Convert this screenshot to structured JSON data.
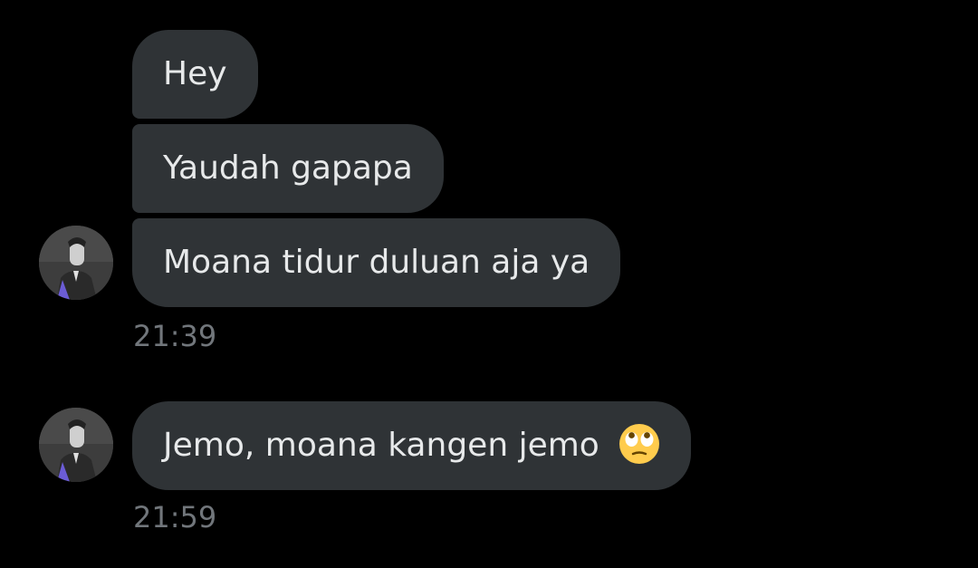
{
  "messages": [
    {
      "text": "Hey"
    },
    {
      "text": "Yaudah gapapa"
    },
    {
      "text": "Moana tidur duluan aja ya"
    },
    {
      "text": "Jemo, moana kangen jemo",
      "emoji": "face-with-rolling-eyes-icon"
    }
  ],
  "timestamps": [
    "21:39",
    "21:59"
  ],
  "colors": {
    "background": "#000000",
    "bubble": "#2f3336",
    "text": "#e7e9ea",
    "timestamp": "#71767b"
  }
}
